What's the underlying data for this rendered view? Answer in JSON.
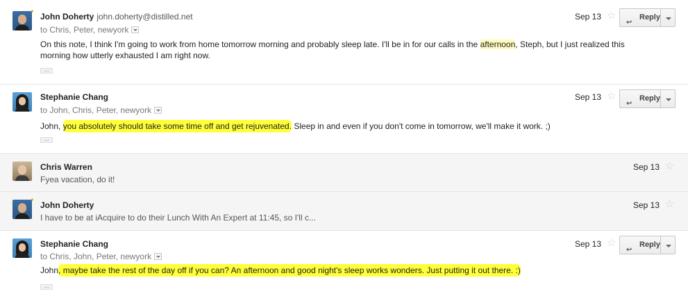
{
  "thread": {
    "reply_label": "Reply",
    "messages": [
      {
        "sender": "John Doherty",
        "email": "john.doherty@distilled.net",
        "recipients": "to Chris, Peter, newyork",
        "date": "Sep 13",
        "body_1": "On this note, I think I'm going to work from home tomorrow morning and probably sleep late. I'll be in for our calls in the ",
        "body_hl": "afternoon",
        "body_2": ", Steph, but I just realized this",
        "body_3": "morning how utterly exhausted I am right now."
      },
      {
        "sender": "Stephanie Chang",
        "recipients": "to John, Chris, Peter, newyork",
        "date": "Sep 13",
        "body_1": "John, ",
        "body_hl": "you absolutely should take some time off and get rejuvenated.",
        "body_2": " Sleep in and even if you don't come in tomorrow, we'll make it work. ;)"
      },
      {
        "sender": "Chris Warren",
        "date": "Sep 13",
        "snippet": "Fyea vacation, do it!"
      },
      {
        "sender": "John Doherty",
        "date": "Sep 13",
        "snippet": "I have to be at iAcquire to do their Lunch With An Expert at 11:45, so I'll c..."
      },
      {
        "sender": "Stephanie Chang",
        "recipients": "to Chris, John, Peter, newyork",
        "date": "Sep 13",
        "body_1": "John",
        "body_hl": ", maybe take the rest of the day off if you can? An afternoon and good night's sleep works wonders. Just putting it out there. :)"
      }
    ]
  },
  "icons": {
    "star": "☆",
    "reply_arrow": "↩",
    "ellipsis": "..."
  }
}
